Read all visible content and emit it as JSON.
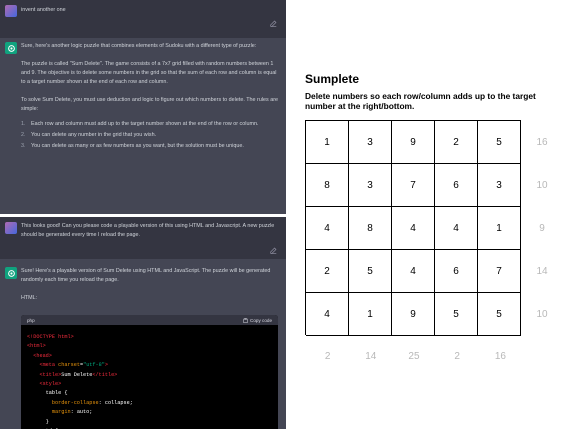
{
  "chat": {
    "user_msg_1": "invent another one",
    "assistant_msg_1": {
      "p1": "Sure, here's another logic puzzle that combines elements of Sudoku with a different type of puzzle:",
      "p2": "The puzzle is called \"Sum Delete\". The game consists of a 7x7 grid filled with random numbers between 1 and 9. The objective is to delete some numbers in the grid so that the sum of each row and column is equal to a target number shown at the end of each row and column.",
      "p3": "To solve Sum Delete, you must use deduction and logic to figure out which numbers to delete. The rules are simple:",
      "rules": [
        {
          "num": "1.",
          "text": "Each row and column must add up to the target number shown at the end of the row or column."
        },
        {
          "num": "2.",
          "text": "You can delete any number in the grid that you wish."
        },
        {
          "num": "3.",
          "text": "You can delete as many or as few numbers as you want, but the solution must be unique."
        }
      ]
    },
    "user_msg_2": "This looks good! Can you please code a playable version of this using HTML and Javascript. A new puzzle should be generated every time I reload the page.",
    "assistant_msg_2": {
      "p1": "Sure! Here's a playable version of Sum Delete using HTML and JavaScript. The puzzle will be generated randomly each time you reload the page.",
      "p2": "HTML:"
    },
    "code_block": {
      "language": "php",
      "copy_label": "Copy code"
    }
  },
  "puzzle": {
    "title": "Sumplete",
    "instructions": "Delete numbers so each row/column adds up to the target number at the right/bottom.",
    "grid": [
      [
        "1",
        "3",
        "9",
        "2",
        "5"
      ],
      [
        "8",
        "3",
        "7",
        "6",
        "3"
      ],
      [
        "4",
        "8",
        "4",
        "4",
        "1"
      ],
      [
        "2",
        "5",
        "4",
        "6",
        "7"
      ],
      [
        "4",
        "1",
        "9",
        "5",
        "5"
      ]
    ],
    "row_targets": [
      "16",
      "10",
      "9",
      "14",
      "10"
    ],
    "col_targets": [
      "2",
      "14",
      "25",
      "2",
      "16"
    ]
  },
  "colors": {
    "chat_bg": "#343541",
    "assistant_bg": "#444654",
    "bot_avatar": "#10a37f",
    "target_text": "#b8b8b8"
  },
  "icons": {
    "edit": "edit-icon",
    "bot": "openai-logo-icon",
    "copy": "clipboard-icon"
  }
}
